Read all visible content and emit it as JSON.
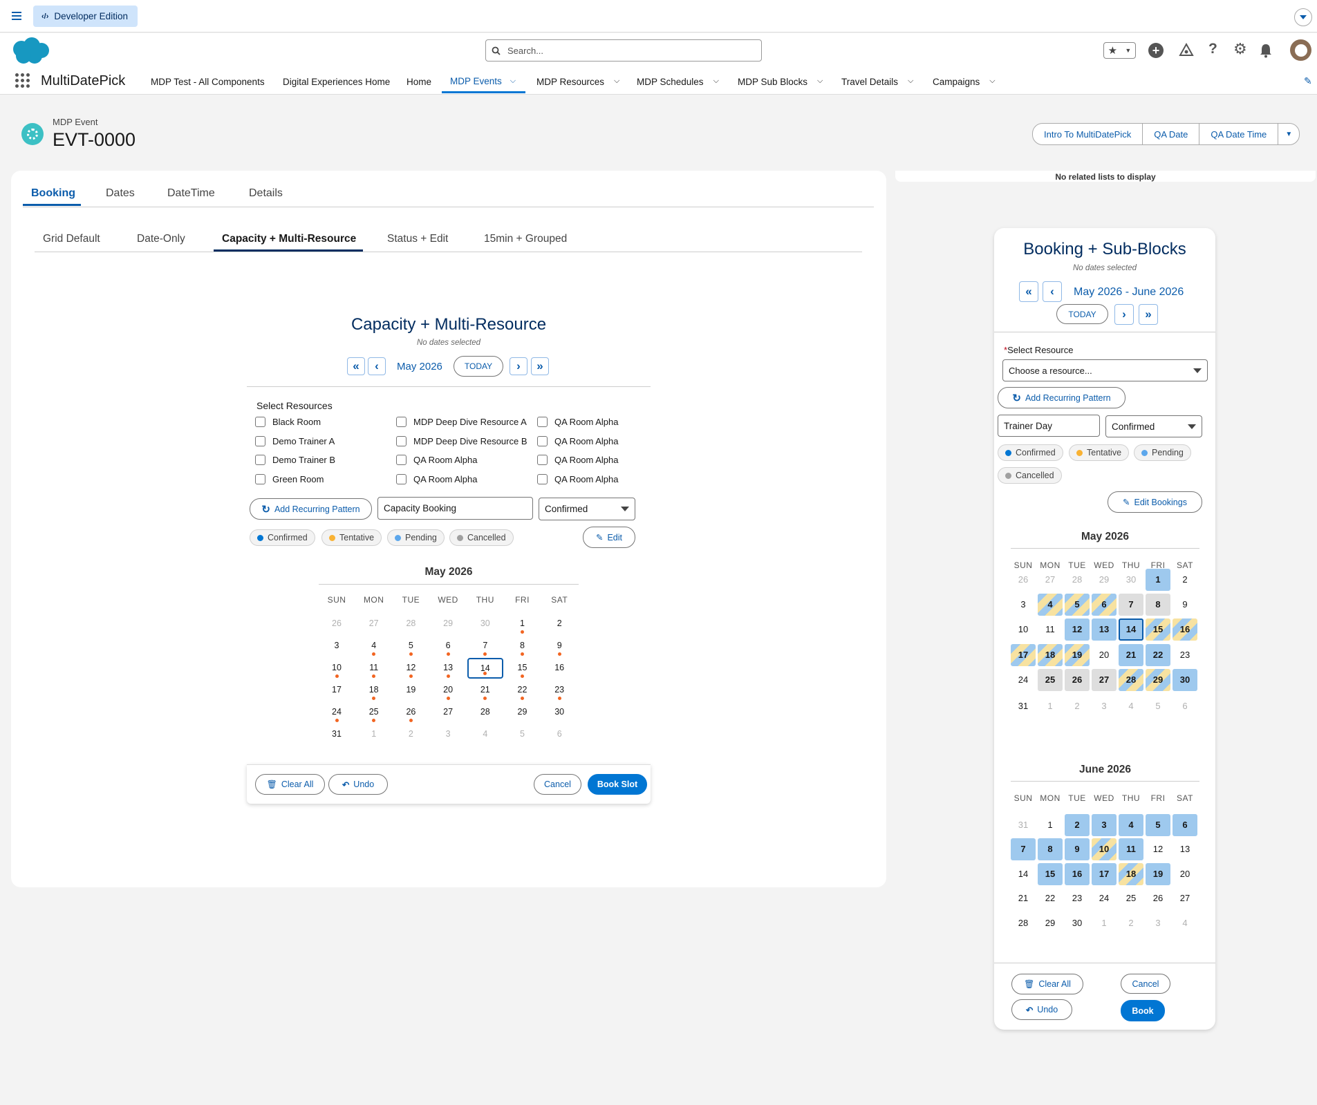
{
  "topbar": {
    "edition": "Developer Edition"
  },
  "header": {
    "search_placeholder": "Search..."
  },
  "nav": {
    "app_name": "MultiDatePick",
    "items": [
      {
        "label": "MDP Test - All Components"
      },
      {
        "label": "Digital Experiences Home"
      },
      {
        "label": "Home"
      },
      {
        "label": "MDP Events"
      },
      {
        "label": "MDP Resources"
      },
      {
        "label": "MDP Schedules"
      },
      {
        "label": "MDP Sub Blocks"
      },
      {
        "label": "Travel Details"
      },
      {
        "label": "Campaigns"
      }
    ]
  },
  "record": {
    "object": "MDP Event",
    "name": "EVT-0000",
    "actions": [
      "Intro To MultiDatePick",
      "QA Date",
      "QA Date Time"
    ]
  },
  "tabs": [
    "Booking",
    "Dates",
    "DateTime",
    "Details"
  ],
  "subtabs": [
    "Grid Default",
    "Date-Only",
    "Capacity + Multi-Resource",
    "Status + Edit",
    "15min + Grouped"
  ],
  "related": {
    "empty": "No related lists to display"
  },
  "left": {
    "title": "Capacity + Multi-Resource",
    "subtitle": "No dates selected",
    "nav": {
      "first": "«",
      "prev": "‹",
      "month": "May 2026",
      "today": "TODAY",
      "next": "›",
      "last": "»"
    },
    "resources_label": "Select Resources",
    "resources": [
      "Black Room",
      "MDP Deep Dive Resource A",
      "QA Room Alpha",
      "Demo Trainer A",
      "MDP Deep Dive Resource B",
      "QA Room Alpha",
      "Demo Trainer B",
      "QA Room Alpha",
      "QA Room Alpha",
      "Green Room",
      "QA Room Alpha",
      "QA Room Alpha"
    ],
    "add_recurring": "Add Recurring Pattern",
    "booking_name": "Capacity Booking",
    "status": "Confirmed",
    "legend": [
      "Confirmed",
      "Tentative",
      "Pending",
      "Cancelled"
    ],
    "edit": "Edit",
    "cal_title": "May 2026",
    "dow": [
      "SUN",
      "MON",
      "TUE",
      "WED",
      "THU",
      "FRI",
      "SAT"
    ],
    "days": [
      "26",
      "27",
      "28",
      "29",
      "30",
      "1",
      "2",
      "3",
      "4",
      "5",
      "6",
      "7",
      "8",
      "9",
      "10",
      "11",
      "12",
      "13",
      "14",
      "15",
      "16",
      "17",
      "18",
      "19",
      "20",
      "21",
      "22",
      "23",
      "24",
      "25",
      "26",
      "27",
      "28",
      "29",
      "30",
      "31",
      "1",
      "2",
      "3",
      "4",
      "5",
      "6"
    ],
    "clear_all": "Clear All",
    "undo": "Undo",
    "cancel": "Cancel",
    "book": "Book Slot"
  },
  "right": {
    "title": "Booking + Sub-Blocks",
    "subtitle": "No dates selected",
    "nav": {
      "first": "«",
      "prev": "‹",
      "range": "May 2026 - June 2026",
      "today": "TODAY",
      "next": "›",
      "last": "»"
    },
    "select_label": "Select Resource",
    "select_placeholder": "Choose a resource...",
    "add_recurring": "Add Recurring Pattern",
    "booking_name": "Trainer Day",
    "status": "Confirmed",
    "legend": [
      "Confirmed",
      "Tentative",
      "Pending",
      "Cancelled"
    ],
    "edit": "Edit Bookings",
    "may_title": "May 2026",
    "june_title": "June 2026",
    "dow": [
      "SUN",
      "MON",
      "TUE",
      "WED",
      "THU",
      "FRI",
      "SAT"
    ],
    "may_days": [
      "26",
      "27",
      "28",
      "29",
      "30",
      "1",
      "2",
      "3",
      "4",
      "5",
      "6",
      "7",
      "8",
      "9",
      "10",
      "11",
      "12",
      "13",
      "14",
      "15",
      "16",
      "17",
      "18",
      "19",
      "20",
      "21",
      "22",
      "23",
      "24",
      "25",
      "26",
      "27",
      "28",
      "29",
      "30",
      "31",
      "1",
      "2",
      "3",
      "4",
      "5",
      "6"
    ],
    "june_days": [
      "31",
      "1",
      "2",
      "3",
      "4",
      "5",
      "6",
      "7",
      "8",
      "9",
      "10",
      "11",
      "12",
      "13",
      "14",
      "15",
      "16",
      "17",
      "18",
      "19",
      "20",
      "21",
      "22",
      "23",
      "24",
      "25",
      "26",
      "27",
      "28",
      "29",
      "30",
      "1",
      "2",
      "3",
      "4"
    ],
    "clear_all": "Clear All",
    "undo": "Undo",
    "cancel": "Cancel",
    "book": "Book"
  },
  "colors": {
    "confirmed": "#0176d3",
    "tentative": "#f9b233",
    "pending": "#5ca7ec",
    "cancelled": "#a0a0a0",
    "event_dot": "#f26522",
    "booked": "#9ec9ee",
    "tentative_fill": "#f7e2a1"
  }
}
